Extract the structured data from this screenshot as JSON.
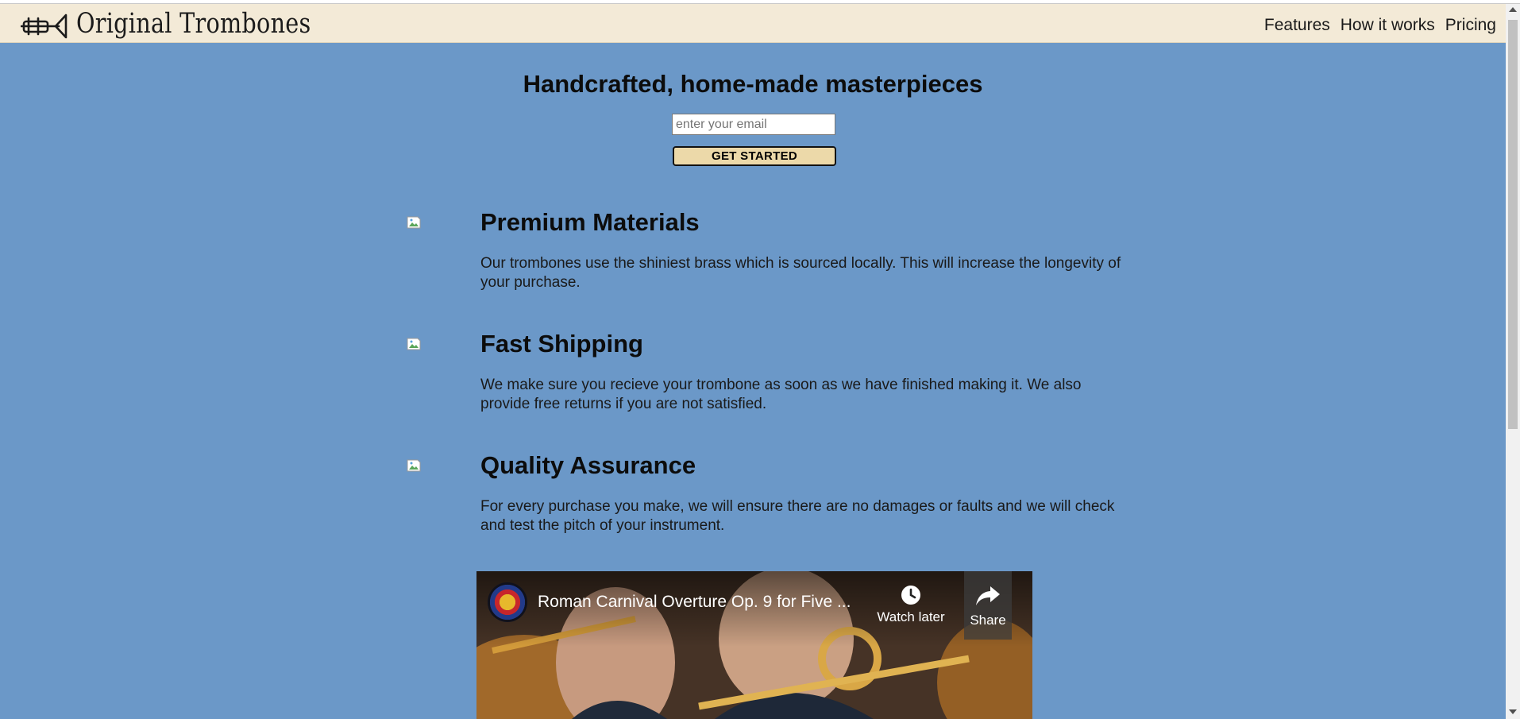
{
  "brand": {
    "name": "Original Trombones",
    "logo_icon": "trombone-logo-icon"
  },
  "nav": {
    "items": [
      {
        "label": "Features"
      },
      {
        "label": "How it works"
      },
      {
        "label": "Pricing"
      }
    ]
  },
  "hero": {
    "title": "Handcrafted, home-made masterpieces",
    "email_placeholder": "enter your email",
    "email_value": "",
    "cta_label": "GET STARTED"
  },
  "features": [
    {
      "title": "Premium Materials",
      "text": "Our trombones use the shiniest brass which is sourced locally. This will increase the longevity of your purchase.",
      "icon": "broken-image-icon"
    },
    {
      "title": "Fast Shipping",
      "text": "We make sure you recieve your trombone as soon as we have finished making it. We also provide free returns if you are not satisfied.",
      "icon": "broken-image-icon"
    },
    {
      "title": "Quality Assurance",
      "text": "For every purchase you make, we will ensure there are no damages or faults and we will check and test the pitch of your instrument.",
      "icon": "broken-image-icon"
    }
  ],
  "video": {
    "title": "Roman Carnival Overture Op. 9 for Five ...",
    "watch_later_label": "Watch later",
    "share_label": "Share"
  },
  "colors": {
    "page_bg": "#6b98c8",
    "header_bg": "#f3ead7",
    "button_bg": "#ecd9a9"
  }
}
